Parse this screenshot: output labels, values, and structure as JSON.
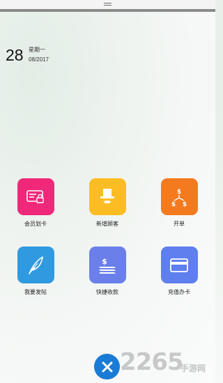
{
  "date": {
    "day": "28",
    "weekday": "星期一",
    "month_year": "08/2017"
  },
  "tiles": [
    {
      "label": "会员划卡",
      "icon": "member-card-icon",
      "color": "#f0287a"
    },
    {
      "label": "新增顾客",
      "icon": "new-customer-icon",
      "color": "#fbbd23"
    },
    {
      "label": "开单",
      "icon": "open-order-icon",
      "color": "#f47a1f"
    },
    {
      "label": "我要发帖",
      "icon": "post-feather-icon",
      "color": "#2f9ae0"
    },
    {
      "label": "快捷收款",
      "icon": "quick-payment-icon",
      "color": "#6b7fea"
    },
    {
      "label": "充值办卡",
      "icon": "recharge-card-icon",
      "color": "#5f7fef"
    }
  ],
  "close_button": {
    "icon": "close-icon",
    "color": "#1a7bd6"
  },
  "watermark": {
    "logo": "2265",
    "site": "手游网"
  }
}
